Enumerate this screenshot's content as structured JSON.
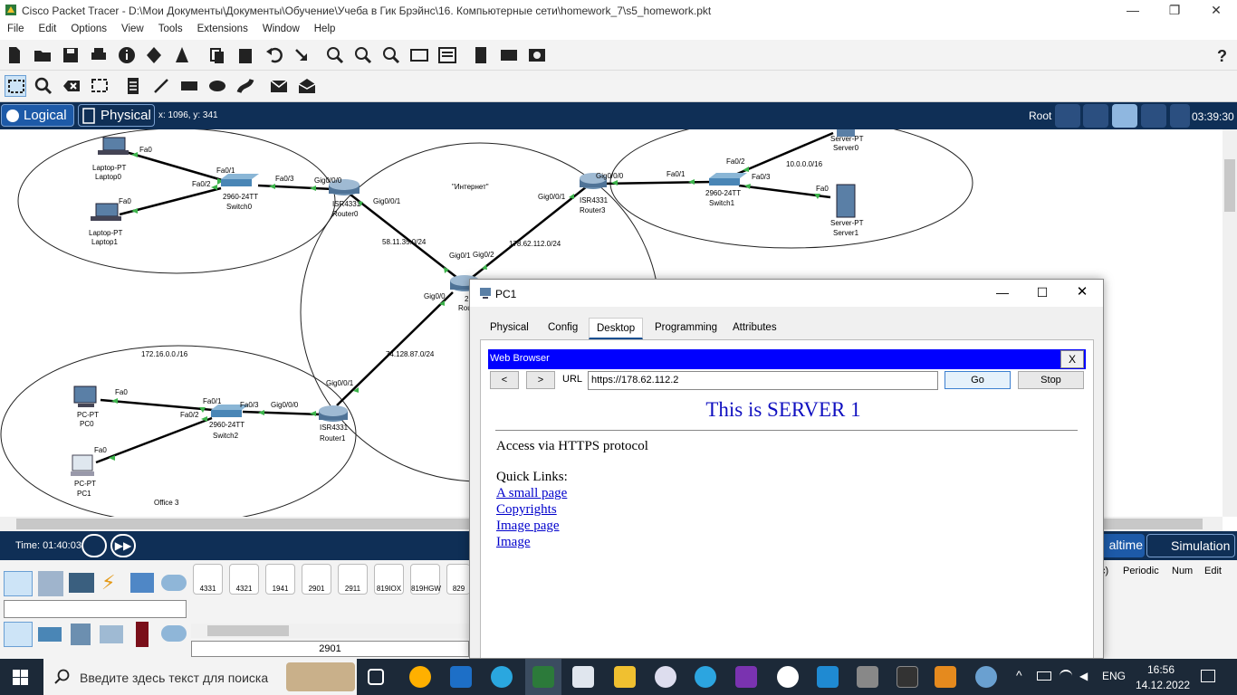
{
  "window": {
    "title": "Cisco Packet Tracer - D:\\Мои Документы\\Документы\\Обучение\\Учеба в Гик Брэйнс\\16. Компьютерные сети\\homework_7\\s5_homework.pkt"
  },
  "menu": [
    "File",
    "Edit",
    "Options",
    "View",
    "Tools",
    "Extensions",
    "Window",
    "Help"
  ],
  "topbar": {
    "logical": "Logical",
    "physical": "Physical",
    "coords": "x: 1096, y: 341",
    "root": "Root",
    "clock": "03:39:30"
  },
  "topology": {
    "nodes": {
      "laptop0": [
        "Laptop-PT",
        "Laptop0"
      ],
      "laptop1": [
        "Laptop-PT",
        "Laptop1"
      ],
      "switch0": [
        "2960-24TT",
        "Switch0"
      ],
      "router0": [
        "ISR4331",
        "Router0"
      ],
      "internet": "\"Интернет\"",
      "router3": [
        "ISR4331",
        "Router3"
      ],
      "switch1": [
        "2960-24TT",
        "Switch1"
      ],
      "server0": [
        "Server-PT",
        "Server0"
      ],
      "server1": [
        "Server-PT",
        "Server1"
      ],
      "pc0": [
        "PC-PT",
        "PC0"
      ],
      "pc1": [
        "PC-PT",
        "PC1"
      ],
      "switch2": [
        "2960-24TT",
        "Switch2"
      ],
      "router1": [
        "ISR4331",
        "Router1"
      ],
      "router2_partial": [
        "2",
        "Rou"
      ]
    },
    "networks": {
      "net_left_top": "58.11.35.0/24",
      "net_right_top": "178.62.112.0/24",
      "net_bottom": "74.128.87.0/24",
      "lan_bottom": "172.16.0.0./16",
      "lan_right": "10.0.0.0/16",
      "office3": "Office 3"
    },
    "ports": {
      "l0": "Fa0",
      "l1": "Fa0",
      "sw0_1": "Fa0/1",
      "sw0_2": "Fa0/2",
      "sw0_3": "Fa0/3",
      "r0_g000": "Gig0/0/0",
      "r0_g001": "Gig0/0/1",
      "r2_g01": "Gig0/1",
      "r2_g02": "Gig0/2",
      "r2_g00": "Gig0/0",
      "r3_g000": "Gig0/0/0",
      "r3_g001": "Gig0/0/1",
      "sw1_1": "Fa0/1",
      "sw1_2": "Fa0/2",
      "sw1_3": "Fa0/3",
      "srv1_fa0": "Fa0",
      "pc0_fa0": "Fa0",
      "pc1_fa0": "Fa0",
      "sw2_1": "Fa0/1",
      "sw2_2": "Fa0/2",
      "sw2_3": "Fa0/3",
      "r1_g000": "Gig0/0/0",
      "r1_g001": "Gig0/0/1"
    }
  },
  "bottom": {
    "time": "Time: 01:40:03",
    "realtime_partial": "altime",
    "simulation": "Simulation",
    "device_models": [
      "4331",
      "4321",
      "1941",
      "2901",
      "2911",
      "819IOX",
      "819HGW",
      "829"
    ],
    "selected_model": "2901",
    "event_columns": [
      "c)",
      "Periodic",
      "Num",
      "Edit"
    ]
  },
  "pc_window": {
    "title": "PC1",
    "tabs": [
      "Physical",
      "Config",
      "Desktop",
      "Programming",
      "Attributes"
    ],
    "active_tab": "Desktop",
    "browser": {
      "header": "Web Browser",
      "close": "X",
      "back": "<",
      "forward": ">",
      "url_label": "URL",
      "url": "https://178.62.112.2",
      "go": "Go",
      "stop": "Stop",
      "heading": "This is SERVER 1",
      "line1": "Access via HTTPS protocol",
      "quick_links": "Quick Links:",
      "links": [
        "A small page",
        "Copyrights",
        "Image page",
        "Image"
      ]
    }
  },
  "taskbar": {
    "search_placeholder": "Введите здесь текст для поиска",
    "lang": "ENG",
    "time": "16:56",
    "date": "14.12.2022"
  },
  "colors": {
    "navy": "#0f2f56",
    "browser_header": "#0000ff",
    "link": "#0000cc",
    "heading": "#1010c0",
    "taskbar": "#1c2938"
  }
}
